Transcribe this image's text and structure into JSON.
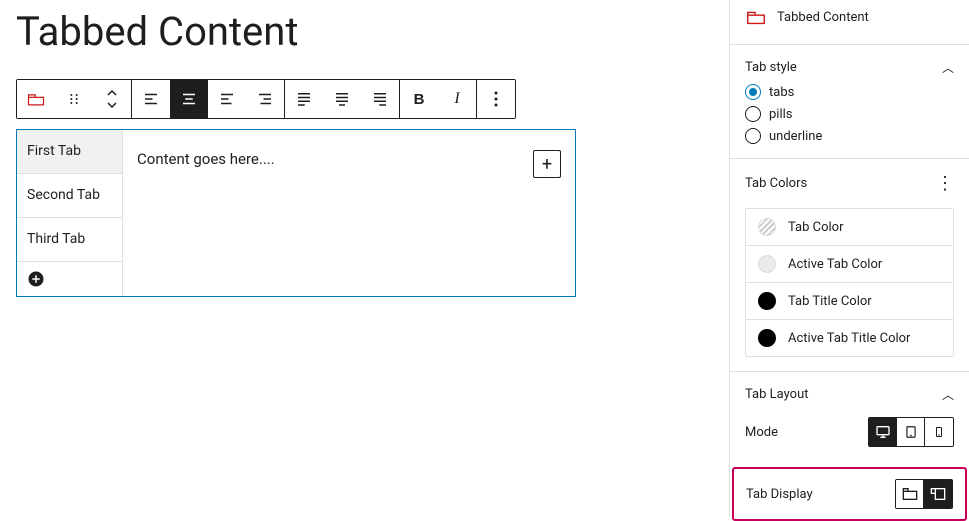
{
  "page": {
    "title": "Tabbed Content"
  },
  "block": {
    "tabs": [
      "First Tab",
      "Second Tab",
      "Third Tab"
    ],
    "content_placeholder": "Content goes here...."
  },
  "sidebar": {
    "block_name": "Tabbed Content",
    "tab_style": {
      "title": "Tab style",
      "options": [
        "tabs",
        "pills",
        "underline"
      ],
      "selected": "tabs"
    },
    "tab_colors": {
      "title": "Tab Colors",
      "items": [
        {
          "label": "Tab Color",
          "swatch": "hatch"
        },
        {
          "label": "Active Tab Color",
          "swatch": "grey"
        },
        {
          "label": "Tab Title Color",
          "swatch": "black"
        },
        {
          "label": "Active Tab Title Color",
          "swatch": "black"
        }
      ]
    },
    "tab_layout": {
      "title": "Tab Layout",
      "mode_label": "Mode",
      "tab_display_label": "Tab Display"
    }
  }
}
